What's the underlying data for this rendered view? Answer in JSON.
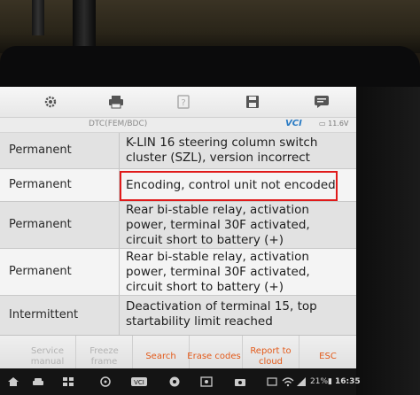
{
  "toolbar": {
    "icons": [
      "gear-icon",
      "printer-icon",
      "help-icon",
      "save-icon",
      "chat-icon"
    ]
  },
  "crumb": {
    "path": "DTC(FEM/BDC)",
    "vci_label": "VCI",
    "battery_voltage": "11.6V"
  },
  "dtc_rows": [
    {
      "type": "Permanent",
      "description": "K-LIN 16 steering column switch cluster (SZL), version incorrect"
    },
    {
      "type": "Permanent",
      "description": "Encoding, control unit not encoded"
    },
    {
      "type": "Permanent",
      "description": "Rear bi-stable relay, activation power, terminal 30F activated, circuit short to battery (+)"
    },
    {
      "type": "Permanent",
      "description": "Rear bi-stable relay, activation power, terminal 30F activated, circuit short to battery (+)"
    },
    {
      "type": "Intermittent",
      "description": "Deactivation of terminal 15, top startability limit reached"
    }
  ],
  "bottom_buttons": {
    "service_manual": "Service manual",
    "freeze_frame": "Freeze frame",
    "search": "Search",
    "erase_codes": "Erase codes",
    "report_to_cloud": "Report to cloud",
    "esc": "ESC"
  },
  "status": {
    "battery_percent": "21%",
    "time": "16:35"
  },
  "colors": {
    "accent": "#e35a1a",
    "highlight_box": "#e01a1a",
    "vci_blue": "#2a7bc4"
  }
}
